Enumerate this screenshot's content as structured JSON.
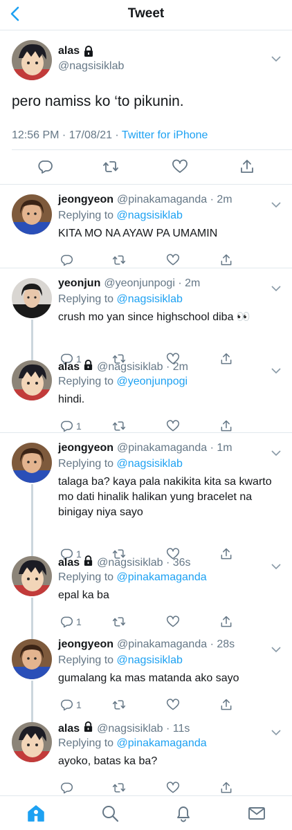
{
  "header": {
    "title": "Tweet"
  },
  "main_tweet": {
    "name": "alas",
    "handle": "@nagsisiklab",
    "text": "pero namiss ko ‘to pikunin.",
    "time": "12:56 PM · 17/08/21 · ",
    "source": "Twitter for iPhone"
  },
  "replying_prefix": "Replying to ",
  "replies": [
    {
      "name": "jeongyeon",
      "locked": false,
      "handle": "@pinakamaganda · 2m",
      "replying_to": "@nagsisiklab",
      "text": "KITA MO NA AYAW PA UMAMIN",
      "reply_count": ""
    },
    {
      "name": "yeonjun",
      "locked": false,
      "handle": "@yeonjunpogi · 2m",
      "replying_to": "@nagsisiklab",
      "text": "crush mo yan since highschool diba 👀",
      "reply_count": "1"
    },
    {
      "name": "alas",
      "locked": true,
      "handle": "@nagsisiklab · 2m",
      "replying_to": "@yeonjunpogi",
      "text": "hindi.",
      "reply_count": "1"
    },
    {
      "name": "jeongyeon",
      "locked": false,
      "handle": "@pinakamaganda · 1m",
      "replying_to": "@nagsisiklab",
      "text": "talaga ba? kaya pala nakikita kita sa kwarto mo dati hinalik halikan yung bracelet na binigay niya sayo",
      "reply_count": "1"
    },
    {
      "name": "alas",
      "locked": true,
      "handle": "@nagsisiklab · 36s",
      "replying_to": "@pinakamaganda",
      "text": "epal ka ba",
      "reply_count": "1"
    },
    {
      "name": "jeongyeon",
      "locked": false,
      "handle": "@pinakamaganda · 28s",
      "replying_to": "@nagsisiklab",
      "text": "gumalang ka mas matanda ako sayo",
      "reply_count": "1"
    },
    {
      "name": "alas",
      "locked": true,
      "handle": "@nagsisiklab · 11s",
      "replying_to": "@pinakamaganda",
      "text": "ayoko, batas ka ba?",
      "reply_count": ""
    }
  ],
  "icons": {
    "back": "chevron-left-icon",
    "caret": "chevron-down-icon",
    "lock": "lock-icon",
    "reply": "reply-icon",
    "retweet": "retweet-icon",
    "like": "heart-icon",
    "share": "share-icon",
    "home": "home-icon",
    "search": "search-icon",
    "notifications": "bell-icon",
    "messages": "mail-icon"
  },
  "colors": {
    "accent": "#1da1f2",
    "muted": "#657786",
    "text": "#14171a",
    "thread_line": "#ccd6dd"
  }
}
